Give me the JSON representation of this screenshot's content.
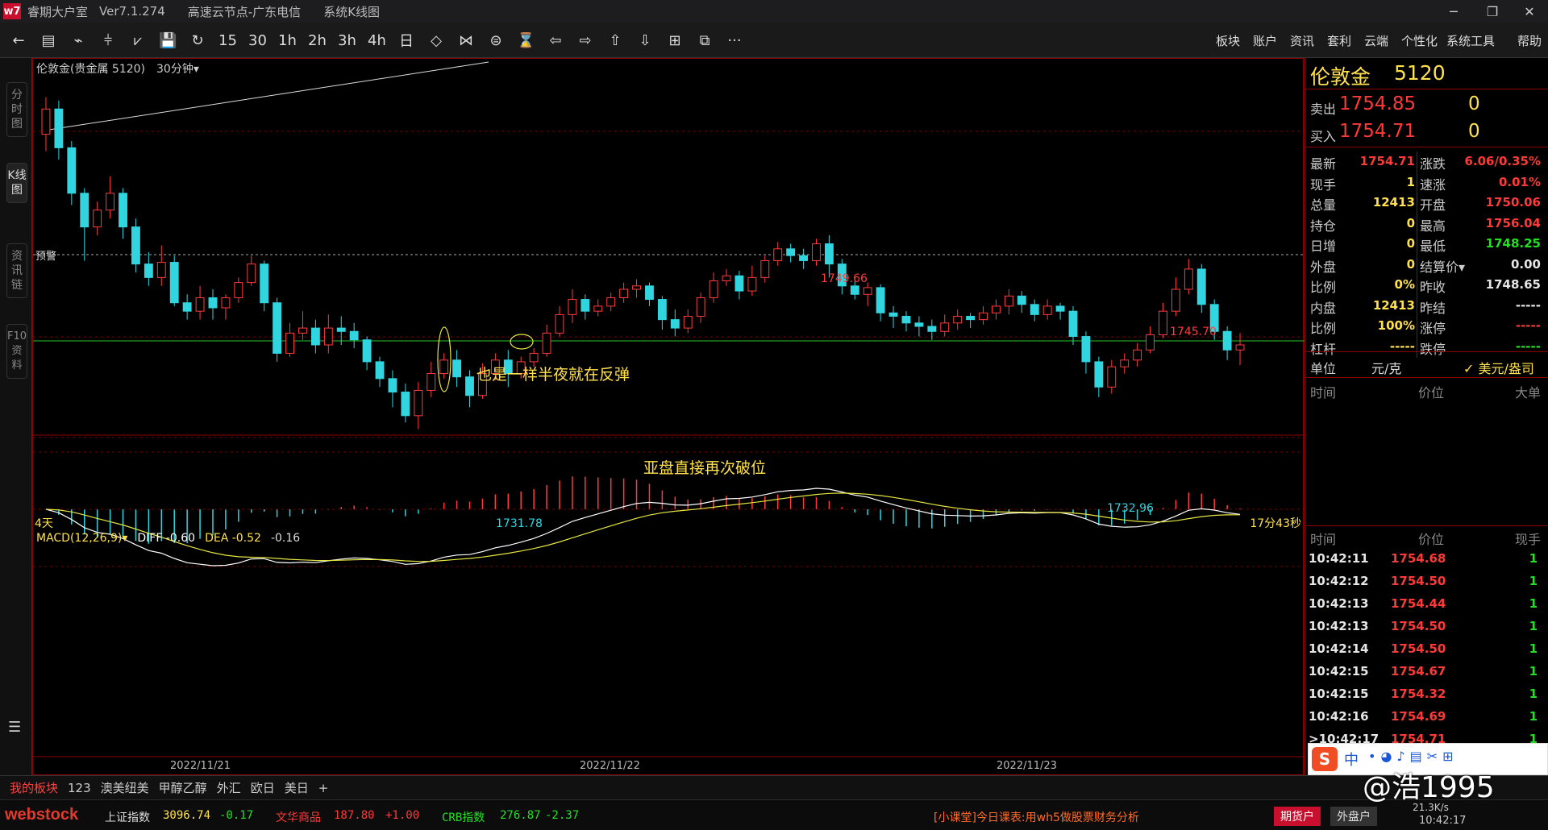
{
  "window": {
    "title": "睿期大户室",
    "version": "Ver7.1.274",
    "node": "高速云节点-广东电信",
    "view": "系统K线图",
    "controls": [
      "─",
      "❐",
      "✕"
    ]
  },
  "toolbar": {
    "buttons": [
      "←",
      "▤",
      "⌁",
      "⫩",
      "⩗",
      "💾",
      "↻",
      "15",
      "30",
      "1h",
      "2h",
      "3h",
      "4h",
      "日",
      "◇",
      "⋈",
      "⊜",
      "⌛",
      "⇦",
      "⇨",
      "⇧",
      "⇩",
      "⊞",
      "⧉",
      "···"
    ],
    "menu": [
      "板块",
      "账户",
      "资讯",
      "套利",
      "云端",
      "个性化",
      "系统工具",
      "帮助"
    ]
  },
  "left_tabs": [
    "分时图",
    "K线图",
    "资讯链",
    "F10资料"
  ],
  "chart": {
    "symbol_label": "伦敦金(贵金属 5120)",
    "period": "30分钟▾",
    "alert_label": "预警",
    "days_label": "4天",
    "countdown": "17分43秒",
    "annotation_1": "也是一样半夜就在反弹",
    "annotation_2": "亚盘直接再次破位",
    "price_high_1": "1749.66",
    "price_high_2": "1745.70",
    "price_low_1": "1731.78",
    "price_low_2": "1732.96",
    "macd_title": "MACD(12,26,9)▾",
    "macd_diff": "DIFF -0.60",
    "macd_dea": "DEA -0.52",
    "macd_val": "-0.16",
    "dates": [
      "2022/11/21",
      "2022/11/22",
      "2022/11/23"
    ],
    "colors": {
      "up": "#ff3b3b",
      "down": "#30d5e0",
      "diff": "#ffffff",
      "dea": "#e6e640",
      "grid": "#7a0000",
      "green_line": "#1fa01f"
    }
  },
  "chart_data": {
    "type": "candlestick",
    "interval": "30分钟",
    "ylim": [
      1730,
      1752
    ],
    "candles": [
      [
        1748.0,
        1749.5,
        1747.0,
        1750.2
      ],
      [
        1749.5,
        1747.2,
        1746.5,
        1750.0
      ],
      [
        1747.2,
        1744.5,
        1743.8,
        1747.6
      ],
      [
        1744.5,
        1742.5,
        1740.5,
        1744.8
      ],
      [
        1742.5,
        1743.5,
        1742.0,
        1744.0
      ],
      [
        1743.5,
        1744.5,
        1743.0,
        1745.5
      ],
      [
        1744.5,
        1742.5,
        1741.8,
        1744.8
      ],
      [
        1742.5,
        1740.3,
        1739.8,
        1743.0
      ],
      [
        1740.3,
        1739.5,
        1739.0,
        1741.0
      ],
      [
        1739.5,
        1740.4,
        1739.0,
        1741.4
      ],
      [
        1740.4,
        1738.0,
        1737.8,
        1740.8
      ],
      [
        1738.0,
        1737.5,
        1737.0,
        1738.5
      ],
      [
        1737.5,
        1738.3,
        1737.0,
        1739.0
      ],
      [
        1738.3,
        1737.7,
        1737.0,
        1738.8
      ],
      [
        1737.7,
        1738.3,
        1737.0,
        1738.5
      ],
      [
        1738.3,
        1739.2,
        1738.0,
        1739.5
      ],
      [
        1739.2,
        1740.3,
        1739.0,
        1740.8
      ],
      [
        1740.3,
        1738.0,
        1737.5,
        1740.5
      ],
      [
        1738.0,
        1735.0,
        1734.5,
        1738.3
      ],
      [
        1735.0,
        1736.2,
        1734.8,
        1736.8
      ],
      [
        1736.2,
        1736.5,
        1735.8,
        1737.5
      ],
      [
        1736.5,
        1735.5,
        1735.0,
        1737.0
      ],
      [
        1735.5,
        1736.5,
        1735.0,
        1737.3
      ],
      [
        1736.5,
        1736.3,
        1735.5,
        1737.2
      ],
      [
        1736.3,
        1735.8,
        1735.3,
        1736.8
      ],
      [
        1735.8,
        1734.5,
        1734.0,
        1736.0
      ],
      [
        1734.5,
        1733.5,
        1733.0,
        1734.8
      ],
      [
        1733.5,
        1732.7,
        1731.8,
        1734.0
      ],
      [
        1732.7,
        1731.3,
        1730.9,
        1733.2
      ],
      [
        1731.3,
        1732.8,
        1730.5,
        1733.3
      ],
      [
        1732.8,
        1733.8,
        1732.4,
        1734.5
      ],
      [
        1733.8,
        1734.6,
        1733.5,
        1735.0
      ],
      [
        1734.6,
        1733.6,
        1733.0,
        1735.2
      ],
      [
        1733.6,
        1732.5,
        1731.8,
        1734.0
      ],
      [
        1732.5,
        1733.8,
        1732.3,
        1734.4
      ],
      [
        1733.8,
        1734.6,
        1733.4,
        1735.0
      ],
      [
        1734.6,
        1733.8,
        1733.0,
        1735.2
      ],
      [
        1733.8,
        1734.5,
        1733.5,
        1734.8
      ],
      [
        1734.5,
        1735.0,
        1734.2,
        1735.3
      ],
      [
        1735.0,
        1736.2,
        1734.8,
        1736.7
      ],
      [
        1736.2,
        1737.3,
        1736.0,
        1737.8
      ],
      [
        1737.3,
        1738.2,
        1736.8,
        1738.8
      ],
      [
        1738.2,
        1737.5,
        1737.0,
        1738.5
      ],
      [
        1737.5,
        1737.8,
        1737.2,
        1738.2
      ],
      [
        1737.8,
        1738.3,
        1737.5,
        1738.6
      ],
      [
        1738.3,
        1738.8,
        1738.0,
        1739.2
      ],
      [
        1738.8,
        1739.0,
        1738.3,
        1739.4
      ],
      [
        1739.0,
        1738.2,
        1737.8,
        1739.2
      ],
      [
        1738.2,
        1737.0,
        1736.4,
        1738.4
      ],
      [
        1737.0,
        1736.5,
        1736.0,
        1737.6
      ],
      [
        1736.5,
        1737.2,
        1736.2,
        1737.6
      ],
      [
        1737.2,
        1738.3,
        1736.8,
        1738.6
      ],
      [
        1738.3,
        1739.3,
        1738.0,
        1739.8
      ],
      [
        1739.3,
        1739.6,
        1739.0,
        1740.0
      ],
      [
        1739.6,
        1738.7,
        1738.2,
        1739.9
      ],
      [
        1738.7,
        1739.5,
        1738.4,
        1740.2
      ],
      [
        1739.5,
        1740.5,
        1739.2,
        1740.8
      ],
      [
        1740.5,
        1741.2,
        1740.2,
        1741.6
      ],
      [
        1741.2,
        1740.8,
        1740.4,
        1741.5
      ],
      [
        1740.8,
        1740.5,
        1740.0,
        1741.2
      ],
      [
        1740.5,
        1741.5,
        1740.2,
        1741.8
      ],
      [
        1741.5,
        1740.3,
        1739.5,
        1742.0
      ],
      [
        1740.3,
        1739.0,
        1738.5,
        1740.6
      ],
      [
        1739.0,
        1738.5,
        1738.2,
        1739.3
      ],
      [
        1738.5,
        1738.9,
        1737.8,
        1739.2
      ],
      [
        1738.9,
        1737.4,
        1736.9,
        1739.1
      ],
      [
        1737.4,
        1737.2,
        1736.5,
        1737.8
      ],
      [
        1737.2,
        1736.8,
        1736.3,
        1737.5
      ],
      [
        1736.8,
        1736.6,
        1736.0,
        1737.2
      ],
      [
        1736.6,
        1736.3,
        1735.8,
        1737.0
      ],
      [
        1736.3,
        1736.8,
        1736.0,
        1737.3
      ],
      [
        1736.8,
        1737.2,
        1736.4,
        1737.6
      ],
      [
        1737.2,
        1737.0,
        1736.5,
        1737.4
      ],
      [
        1737.0,
        1737.4,
        1736.7,
        1737.8
      ],
      [
        1737.4,
        1737.8,
        1737.0,
        1738.2
      ],
      [
        1737.8,
        1738.4,
        1737.3,
        1738.8
      ],
      [
        1738.4,
        1737.9,
        1737.4,
        1738.7
      ],
      [
        1737.9,
        1737.3,
        1736.9,
        1738.2
      ],
      [
        1737.3,
        1737.8,
        1737.0,
        1738.2
      ],
      [
        1737.8,
        1737.5,
        1737.0,
        1738.0
      ],
      [
        1737.5,
        1736.0,
        1735.5,
        1737.8
      ],
      [
        1736.0,
        1734.5,
        1733.8,
        1736.3
      ],
      [
        1734.5,
        1733.0,
        1732.4,
        1734.8
      ],
      [
        1733.0,
        1734.2,
        1732.6,
        1734.6
      ],
      [
        1734.2,
        1734.6,
        1733.8,
        1735.0
      ],
      [
        1734.6,
        1735.2,
        1734.2,
        1735.6
      ],
      [
        1735.2,
        1736.1,
        1735.0,
        1736.6
      ],
      [
        1736.1,
        1737.5,
        1735.9,
        1738.0
      ],
      [
        1737.5,
        1738.8,
        1737.2,
        1739.5
      ],
      [
        1738.8,
        1740.0,
        1738.5,
        1740.6
      ],
      [
        1740.0,
        1737.9,
        1737.4,
        1740.3
      ],
      [
        1737.9,
        1736.3,
        1735.8,
        1738.2
      ],
      [
        1736.3,
        1735.2,
        1734.6,
        1736.6
      ],
      [
        1735.2,
        1735.5,
        1734.3,
        1736.2
      ]
    ]
  },
  "right_panel": {
    "symbol": "伦敦金",
    "code": "5120",
    "sell_label": "卖出",
    "sell_price": "1754.85",
    "sell_vol": "0",
    "buy_label": "买入",
    "buy_price": "1754.71",
    "buy_vol": "0",
    "quotes": [
      {
        "l1": "最新",
        "v1": "1754.71",
        "c1": "red",
        "l2": "涨跌",
        "v2": "6.06/0.35%",
        "c2": "red"
      },
      {
        "l1": "现手",
        "v1": "1",
        "c1": "yel",
        "l2": "速涨",
        "v2": "0.01%",
        "c2": "red"
      },
      {
        "l1": "总量",
        "v1": "12413",
        "c1": "yel",
        "l2": "开盘",
        "v2": "1750.06",
        "c2": "red"
      },
      {
        "l1": "持仓",
        "v1": "0",
        "c1": "yel",
        "l2": "最高",
        "v2": "1756.04",
        "c2": "red"
      },
      {
        "l1": "日增",
        "v1": "0",
        "c1": "yel",
        "l2": "最低",
        "v2": "1748.25",
        "c2": "grn"
      },
      {
        "l1": "外盘",
        "v1": "0",
        "c1": "yel",
        "l2": "结算价▾",
        "v2": "0.00",
        "c2": "wht"
      },
      {
        "l1": "比例",
        "v1": "0%",
        "c1": "yel",
        "l2": "昨收",
        "v2": "1748.65",
        "c2": "wht"
      },
      {
        "l1": "内盘",
        "v1": "12413",
        "c1": "yel",
        "l2": "昨结",
        "v2": "-----",
        "c2": "wht"
      },
      {
        "l1": "比例",
        "v1": "100%",
        "c1": "yel",
        "l2": "涨停",
        "v2": "-----",
        "c2": "red"
      },
      {
        "l1": "杠杆",
        "v1": "-----",
        "c1": "yel",
        "l2": "跌停",
        "v2": "-----",
        "c2": "grn"
      }
    ],
    "unit_label": "单位",
    "unit_value": "元/克",
    "unit_alt": "✓ 美元/盎司",
    "depth_headers": [
      "时间",
      "价位",
      "大单"
    ],
    "tick_headers": [
      "时间",
      "价位",
      "现手"
    ],
    "ticks": [
      {
        "t": "10:42:11",
        "p": "1754.68",
        "v": "1"
      },
      {
        "t": "10:42:12",
        "p": "1754.50",
        "v": "1"
      },
      {
        "t": "10:42:13",
        "p": "1754.44",
        "v": "1"
      },
      {
        "t": "10:42:13",
        "p": "1754.50",
        "v": "1"
      },
      {
        "t": "10:42:14",
        "p": "1754.50",
        "v": "1"
      },
      {
        "t": "10:42:15",
        "p": "1754.67",
        "v": "1"
      },
      {
        "t": "10:42:15",
        "p": "1754.32",
        "v": "1"
      },
      {
        "t": "10:42:16",
        "p": "1754.69",
        "v": "1"
      },
      {
        "t": ">10:42:17",
        "p": "1754.71",
        "v": "1"
      }
    ]
  },
  "bottom_tabs": [
    "我的板块",
    "123",
    "澳美纽美",
    "甲醇乙醇",
    "外汇",
    "欧日",
    "美日",
    "+"
  ],
  "status": {
    "brand": "webstock",
    "i1_name": "上证指数",
    "i1_val": "3096.74",
    "i1_chg": "-0.17",
    "i2_name": "文华商品",
    "i2_val": "187.80",
    "i2_chg": "+1.00",
    "i3_name": "CRB指数",
    "i3_val": "276.87",
    "i3_chg": "-2.37",
    "news": "[小课堂]今日课表:用wh5做股票财务分析",
    "btn_futures": "期货户",
    "btn_foreign": "外盘户",
    "speed": "21.3K/s",
    "clock": "10:42:17",
    "watermark": "@浩1995",
    "ime": "中"
  }
}
